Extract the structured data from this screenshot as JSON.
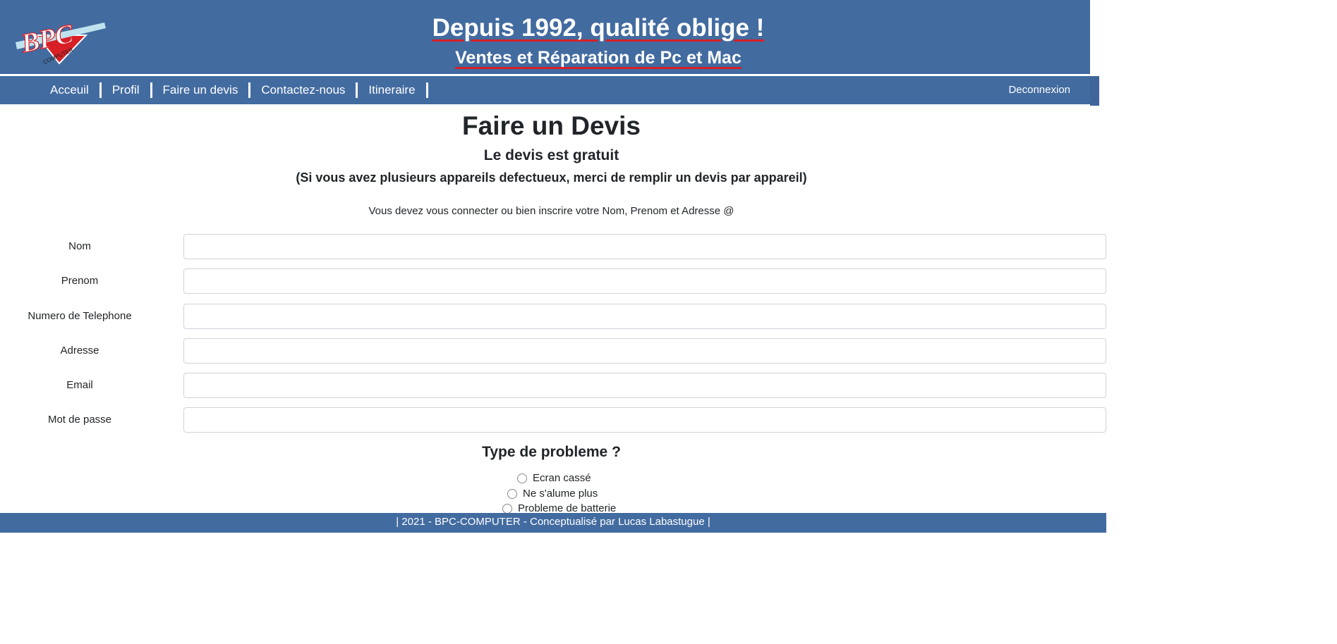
{
  "header": {
    "logo_text": "BPC",
    "logo_subtext": "COMPUTER",
    "tagline": "Depuis 1992, qualité oblige !",
    "subtagline": "Ventes et Réparation de Pc et Mac",
    "underline_color": "#d81f26",
    "background_color": "#426ba0"
  },
  "nav": {
    "items": [
      {
        "label": "Acceuil"
      },
      {
        "label": "Profil"
      },
      {
        "label": "Faire un devis"
      },
      {
        "label": "Contactez-nous"
      },
      {
        "label": "Itineraire"
      }
    ],
    "logout_label": "Deconnexion"
  },
  "main": {
    "title": "Faire un Devis",
    "subtitle": "Le devis est gratuit",
    "note": "(Si vous avez plusieurs appareils defectueux, merci de remplir un devis par appareil)",
    "login_hint": "Vous devez vous connecter ou bien inscrire votre Nom, Prenom et Adresse @"
  },
  "form": {
    "fields": [
      {
        "label": "Nom",
        "value": ""
      },
      {
        "label": "Prenom",
        "value": ""
      },
      {
        "label": "Numero de Telephone",
        "value": ""
      },
      {
        "label": "Adresse",
        "value": ""
      },
      {
        "label": "Email",
        "value": ""
      },
      {
        "label": "Mot de passe",
        "value": ""
      }
    ]
  },
  "problem": {
    "title": "Type de probleme ?",
    "options": [
      {
        "label": "Ecran cassé",
        "checked": false
      },
      {
        "label": "Ne s'alume plus",
        "checked": false
      },
      {
        "label": "Probleme de batterie",
        "checked": false
      }
    ]
  },
  "footer": {
    "text": "| 2021 - BPC-COMPUTER - Conceptualisé par Lucas Labastugue |"
  }
}
